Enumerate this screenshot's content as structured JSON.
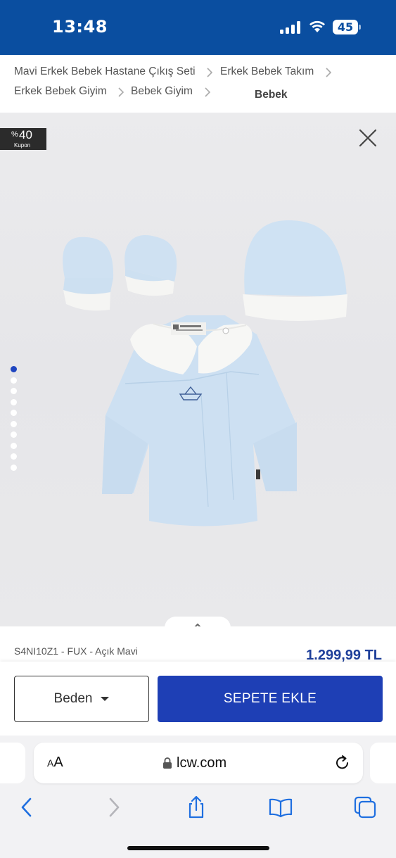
{
  "status_bar": {
    "time": "13:48",
    "battery": "45",
    "icons": [
      "signal-icon",
      "wifi-icon",
      "battery-icon"
    ],
    "bg_color": "#0a4ea0"
  },
  "breadcrumb": {
    "items": [
      "Mavi Erkek Bebek Hastane Çıkış Seti",
      "Erkek Bebek Takım",
      "Erkek Bebek Giyim",
      "Bebek Giyim"
    ],
    "current": "Bebek"
  },
  "gallery": {
    "coupon_percent_sign": "%",
    "coupon_value": "40",
    "coupon_label": "Kupon",
    "active_dot": 1,
    "dot_count": 10,
    "close_icon": "close-icon",
    "expand_icon": "chevron-up-icon"
  },
  "product": {
    "sku": "S4NI10Z1 - FUX - Açık Mavi",
    "price": "1.299,99 TL",
    "price_color": "#1e3f9a"
  },
  "actions": {
    "size_label": "Beden",
    "add_to_cart_label": "SEPETE EKLE",
    "add_to_cart_color": "#1e3fb5"
  },
  "safari": {
    "text_size_label_small": "A",
    "text_size_label_large": "A",
    "url": "lcw.com",
    "toolbar_icons": [
      "back-icon",
      "forward-icon",
      "share-icon",
      "bookmarks-icon",
      "tabs-icon"
    ]
  }
}
